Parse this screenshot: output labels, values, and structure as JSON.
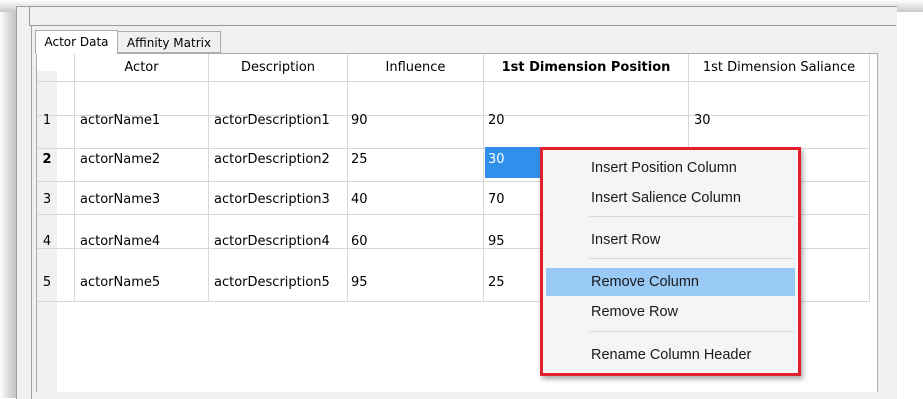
{
  "tabs": [
    {
      "label": "Actor Data",
      "active": true
    },
    {
      "label": "Affinity Matrix",
      "active": false
    }
  ],
  "table": {
    "columns": [
      "Actor",
      "Description",
      "Influence",
      "1st Dimension Position",
      "1st Dimension Saliance"
    ],
    "bold_column_index": 3,
    "rows": [
      {
        "num": "1",
        "actor": "actorName1",
        "description": "actorDescription1",
        "influence": "90",
        "position": "20",
        "salience": "30"
      },
      {
        "num": "2",
        "actor": "actorName2",
        "description": "actorDescription2",
        "influence": "25",
        "position": "30",
        "salience": ""
      },
      {
        "num": "3",
        "actor": "actorName3",
        "description": "actorDescription3",
        "influence": "40",
        "position": "70",
        "salience": ""
      },
      {
        "num": "4",
        "actor": "actorName4",
        "description": "actorDescription4",
        "influence": "60",
        "position": "95",
        "salience": ""
      },
      {
        "num": "5",
        "actor": "actorName5",
        "description": "actorDescription5",
        "influence": "95",
        "position": "25",
        "salience": ""
      }
    ],
    "selected_row": 2,
    "selected_column": "1st Dimension Position"
  },
  "context_menu": {
    "items": [
      {
        "label": "Insert Position Column",
        "highlighted": false
      },
      {
        "label": "Insert Salience Column",
        "highlighted": false
      },
      {
        "label": "Insert Row",
        "highlighted": false
      },
      {
        "label": "Remove Column",
        "highlighted": true
      },
      {
        "label": "Remove Row",
        "highlighted": false
      },
      {
        "label": "Rename Column Header",
        "highlighted": false
      }
    ]
  },
  "colors": {
    "selection": "#2f8fea",
    "menu_highlight": "#99c9f5",
    "annotation_outline": "#e0202d"
  }
}
